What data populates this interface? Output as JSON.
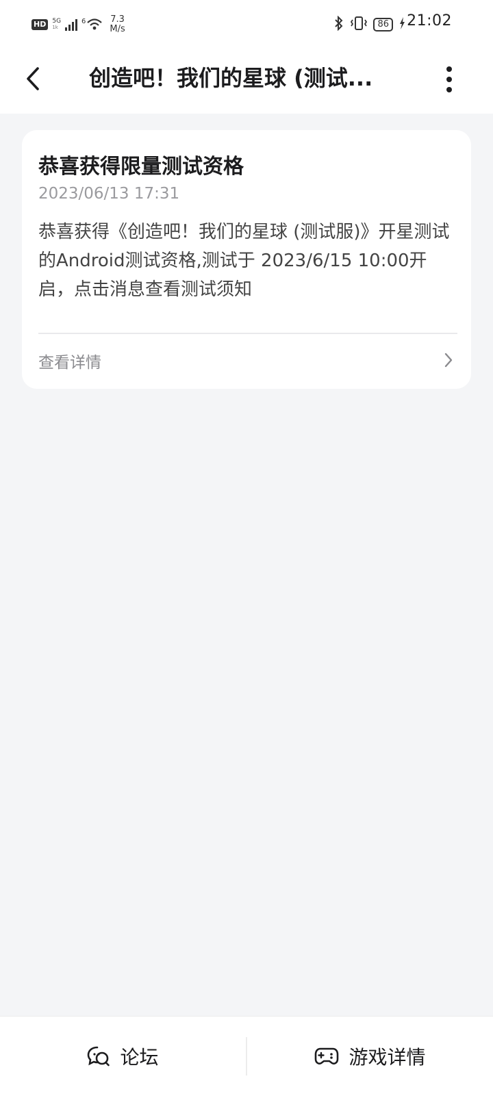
{
  "status_bar": {
    "hd": "HD",
    "network_5g": "5G",
    "network_1k": "1k",
    "wifi_sup": "6",
    "speed_value": "7.3",
    "speed_unit": "M/s",
    "battery": "86",
    "time": "21:02",
    "icons": [
      "hd-icon",
      "signal-icon",
      "wifi-icon",
      "bluetooth-icon",
      "vibrate-icon",
      "battery-icon",
      "charging-icon"
    ]
  },
  "header": {
    "title": "创造吧！我们的星球 (测试...",
    "icons": [
      "back-icon",
      "more-icon"
    ]
  },
  "message": {
    "title": "恭喜获得限量测试资格",
    "time": "2023/06/13 17:31",
    "body": "恭喜获得《创造吧！我们的星球 (测试服)》开星测试的Android测试资格,测试于 2023/6/15 10:00开启，点击消息查看测试须知",
    "detail_label": "查看详情"
  },
  "bottom_bar": {
    "forum_label": "论坛",
    "game_detail_label": "游戏详情",
    "icons": [
      "forum-icon",
      "gamepad-icon"
    ]
  }
}
